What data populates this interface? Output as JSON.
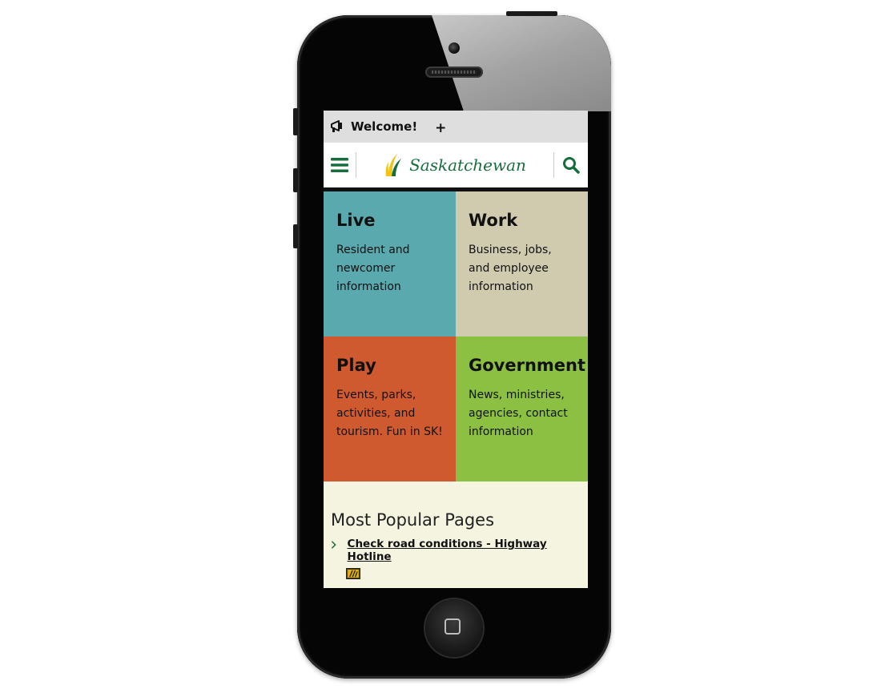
{
  "banner": {
    "welcome_label": "Welcome!",
    "expand_label": "+",
    "icon": "megaphone-icon"
  },
  "header": {
    "logo_text": "Saskatchewan",
    "menu_icon": "hamburger-menu-icon",
    "search_icon": "search-icon",
    "accent_color": "#166e3c"
  },
  "tiles": [
    {
      "title": "Live",
      "description": "Resident and newcomer information",
      "color": "#5aa9ae"
    },
    {
      "title": "Work",
      "description": "Business, jobs, and employee information",
      "color": "#d0cbae"
    },
    {
      "title": "Play",
      "description": "Events, parks, activities, and tourism. Fun in SK!",
      "color": "#d05a30"
    },
    {
      "title": "Government",
      "description": "News, ministries, agencies, contact information",
      "color": "#8bc043"
    }
  ],
  "popular": {
    "title": "Most Popular Pages",
    "items": [
      {
        "label": "Check road conditions - Highway Hotline",
        "icon": "highway-hotline-icon"
      }
    ]
  }
}
